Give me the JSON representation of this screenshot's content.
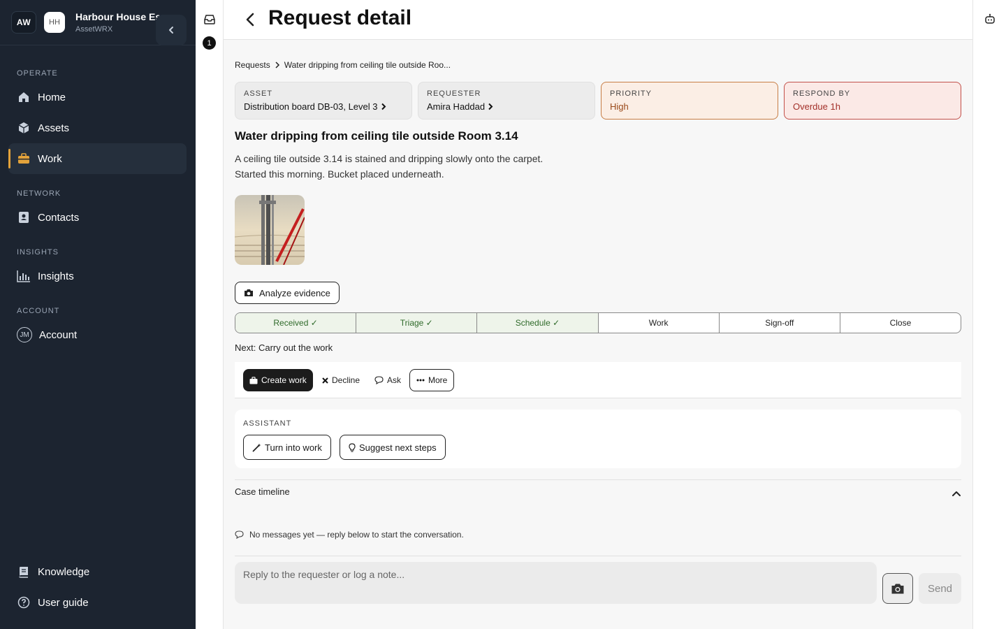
{
  "sidebar": {
    "logo": "AW",
    "org_avatar": "HH",
    "org_name": "Harbour House Es...",
    "org_sub": "AssetWRX",
    "sections": {
      "operate": "OPERATE",
      "network": "NETWORK",
      "insights": "INSIGHTS",
      "account": "ACCOUNT"
    },
    "items": {
      "home": "Home",
      "assets": "Assets",
      "work": "Work",
      "contacts": "Contacts",
      "insights": "Insights",
      "account": "Account",
      "knowledge": "Knowledge",
      "user_guide": "User guide"
    },
    "account_initials": "JM",
    "accent": "#e2a23b"
  },
  "rail": {
    "badge_count": "1"
  },
  "header": {
    "title": "Request detail"
  },
  "breadcrumb": {
    "root": "Requests",
    "current": "Water dripping from ceiling tile outside Roo..."
  },
  "cards": {
    "asset": {
      "label": "ASSET",
      "value": "Distribution board DB-03, Level 3"
    },
    "requester": {
      "label": "REQUESTER",
      "value": "Amira Haddad"
    },
    "priority": {
      "label": "PRIORITY",
      "value": "High"
    },
    "respond_by": {
      "label": "RESPOND BY",
      "value": "Overdue 1h"
    }
  },
  "request": {
    "title": "Water dripping from ceiling tile outside Room 3.14",
    "description_line1": "A ceiling tile outside 3.14 is stained and dripping slowly onto the carpet.",
    "description_line2": "Started this morning. Bucket placed underneath."
  },
  "analyze_label": "Analyze evidence",
  "stages": [
    {
      "label": "Received ✓",
      "done": true
    },
    {
      "label": "Triage ✓",
      "done": true
    },
    {
      "label": "Schedule ✓",
      "done": true
    },
    {
      "label": "Work",
      "done": false
    },
    {
      "label": "Sign-off",
      "done": false
    },
    {
      "label": "Close",
      "done": false
    }
  ],
  "next_step": "Next: Carry out the work",
  "actions": {
    "create_work": "Create work",
    "decline": "Decline",
    "ask": "Ask",
    "more": "More"
  },
  "assistant": {
    "label": "ASSISTANT",
    "turn_into_work": "Turn into work",
    "suggest_next_steps": "Suggest next steps"
  },
  "timeline": {
    "title": "Case timeline",
    "empty_message": "No messages yet — reply below to start the conversation."
  },
  "reply": {
    "placeholder": "Reply to the requester or log a note...",
    "send": "Send"
  }
}
